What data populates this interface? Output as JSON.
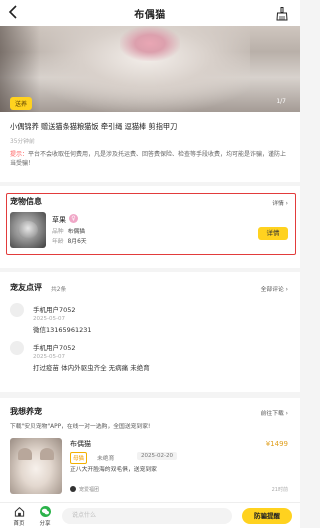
{
  "header": {
    "title": "布偶猫",
    "back_icon": "chevron-left-icon",
    "right_icon": "broom-icon"
  },
  "hero": {
    "badge": "送养",
    "counter": "1/7"
  },
  "post": {
    "title": "小偶锦养 赠送猫条猫粮猫饭 牵引绳 逗猫棒 剪指甲刀",
    "time": "35分钟前",
    "notice_label": "提示：",
    "notice_text": "平台不会收取任何费用，凡是涉及托运费、回答费保险、检查等手段收费，均可能是诈骗，谨防上当受骗！"
  },
  "pet_info": {
    "section_title": "宠物信息",
    "detail_link": "详情",
    "name": "草果",
    "gender_icon": "female-icon",
    "species_label": "品种",
    "species": "布偶猫",
    "age_label": "年龄",
    "age": "8月6天",
    "detail_button": "详情"
  },
  "reviews": {
    "section_title": "宠友点评",
    "count": "共2条",
    "all_link": "全部评论",
    "items": [
      {
        "user": "手机用户7052",
        "date": "2025-05-07",
        "content": "微信13165961231"
      },
      {
        "user": "手机用户7052",
        "date": "2025-05-07",
        "content": "打过疫苗 体内外驱虫齐全 无病痛 未绝育"
      }
    ]
  },
  "want_pet": {
    "section_title": "我想养宠",
    "all_link": "前往下载",
    "promo": "下载\"安贝宠物\"APP，在线一对一选购，全国送宠到家!",
    "card": {
      "name": "布偶猫",
      "price": "¥1499",
      "tag1": "母猫",
      "tag2": "未绝育",
      "date": "2025-02-20",
      "desc": "正八大开脸海的双毛俱，送宠到家",
      "shop": "宠爱福团",
      "time": "21时前"
    }
  },
  "bottom_bar": {
    "home_label": "首页",
    "wechat_label": "分享",
    "comment_placeholder": "说点什么",
    "fraud_button": "防骗提醒"
  }
}
